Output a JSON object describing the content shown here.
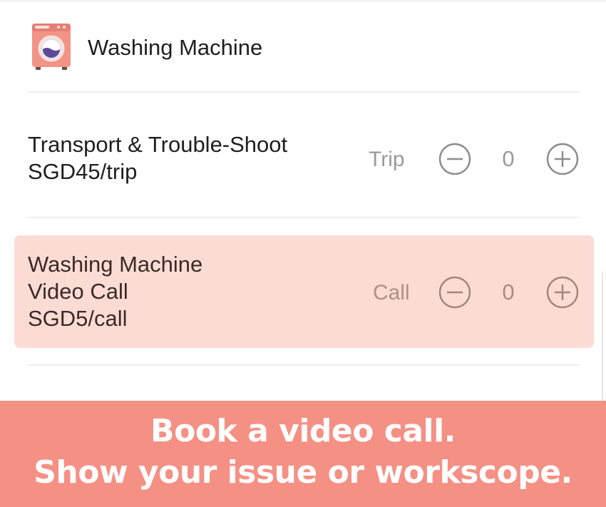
{
  "header": {
    "title": "Washing Machine",
    "icon": "washing-machine-icon"
  },
  "services": [
    {
      "name": "Transport & Trouble-Shoot",
      "price": "SGD45/trip",
      "unit": "Trip",
      "quantity": "0",
      "highlighted": false
    },
    {
      "name_line1": "Washing Machine",
      "name_line2": "Video Call",
      "price": "SGD5/call",
      "unit": "Call",
      "quantity": "0",
      "highlighted": true
    }
  ],
  "banner": {
    "line1": "Book a video call.",
    "line2": "Show your issue or workscope."
  },
  "colors": {
    "banner_background": "#f59085",
    "highlight_row": "#fbdcd5",
    "icon_body": "#f19486",
    "drum_water": "#5b4a9c"
  }
}
